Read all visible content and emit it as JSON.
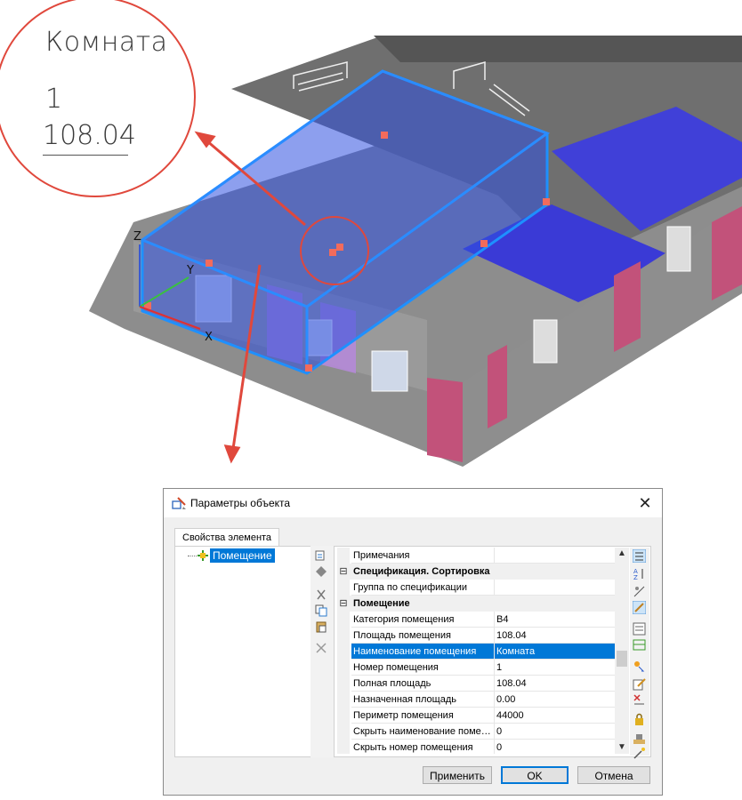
{
  "callout": {
    "title": "Комната",
    "number": "1",
    "area": "108.04"
  },
  "scene": {
    "axis_labels": [
      "Z",
      "Y",
      "X"
    ]
  },
  "dialog": {
    "title": "Параметры объекта",
    "close_glyph": "✕",
    "tab_label": "Свойства элемента",
    "tree": {
      "node_label": "Помещение"
    },
    "properties": [
      {
        "type": "prop",
        "name": "Примечания",
        "value": ""
      },
      {
        "type": "cat",
        "name": "Спецификация. Сортировка",
        "expander": "⊟"
      },
      {
        "type": "prop",
        "name": "Группа по спецификации",
        "value": ""
      },
      {
        "type": "cat",
        "name": "Помещение",
        "expander": "⊟"
      },
      {
        "type": "prop",
        "name": "Категория помещения",
        "value": "B4"
      },
      {
        "type": "prop",
        "name": "Площадь помещения",
        "value": "108.04"
      },
      {
        "type": "prop",
        "name": "Наименование помещения",
        "value": "Комната",
        "selected": true
      },
      {
        "type": "prop",
        "name": "Номер помещения",
        "value": "1"
      },
      {
        "type": "prop",
        "name": "Полная площадь",
        "value": "108.04"
      },
      {
        "type": "prop",
        "name": "Назначенная площадь",
        "value": "0.00"
      },
      {
        "type": "prop",
        "name": "Периметр помещения",
        "value": "44000"
      },
      {
        "type": "prop",
        "name": "Скрыть наименование поме…",
        "value": "0"
      },
      {
        "type": "prop",
        "name": "Скрыть номер помещения",
        "value": "0"
      }
    ],
    "buttons": {
      "apply": "Применить",
      "ok": "OK",
      "cancel": "Отмена"
    }
  },
  "colors": {
    "selection_blue": "#0078d7",
    "room_fill": "#3a3ad6",
    "callout_red": "#e0483c"
  }
}
